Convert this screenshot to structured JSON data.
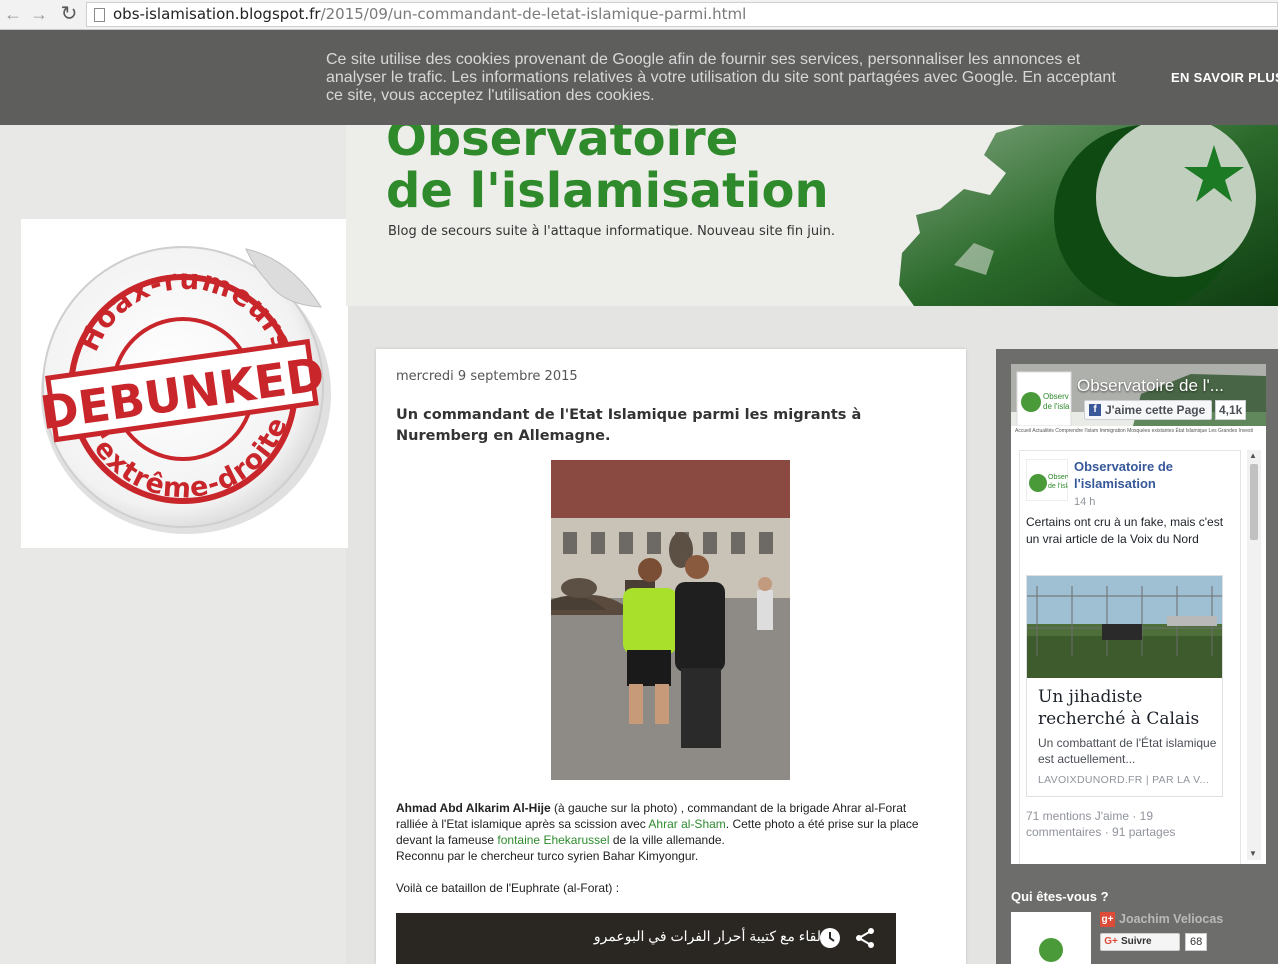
{
  "browser": {
    "url_host": "obs-islamisation.blogspot.fr",
    "url_path": "/2015/09/un-commandant-de-letat-islamique-parmi.html"
  },
  "cookie_banner": {
    "text": "Ce site utilise des cookies provenant de Google afin de fournir ses services, personnaliser les annonces et analyser le trafic. Les informations relatives à votre utilisation du site sont partagées avec Google. En acceptant ce site, vous acceptez l'utilisation des cookies.",
    "learn_more": "EN SAVOIR PLUS"
  },
  "sticker": {
    "top_text": "Hoax-rumeurs",
    "stamp": "DEBUNKED",
    "bottom_text": "d'extrême-droite"
  },
  "header": {
    "title_line1": "Observatoire",
    "title_line2": "de l'islamisation",
    "description": "Blog de secours suite à l'attaque informatique. Nouveau site fin juin."
  },
  "post": {
    "date": "mercredi 9 septembre 2015",
    "title": "Un commandant de l'Etat Islamique parmi les migrants à Nuremberg en Allemagne.",
    "body": {
      "name": "Ahmad Abd Alkarim Al-Hije",
      "p1a": " (à gauche sur la photo) , commandant de la brigade Ahrar al-Forat ralliée à l'Etat islamique après sa scission avec ",
      "link1": "Ahrar al-Sham",
      "p1b": ". Cette photo a été prise sur la place devant la fameuse ",
      "link2": "fontaine Ehekarussel",
      "p1c": " de la ville allemande.",
      "p2": "Reconnu par le chercheur turco syrien Bahar Kimyongur.",
      "p3": "Voilà ce bataillon de l'Euphrate (al-Forat) :"
    },
    "video_title": "لقاء مع كتيبة أحرار الفرات في البوعمرو"
  },
  "sidebar": {
    "facebook": {
      "page_name": "Observatoire de l'...",
      "like_button": "J'aime cette Page",
      "like_count": "4,1k",
      "post_author": "Observatoire de l'islamisation",
      "post_time": "14 h",
      "post_text": "Certains ont cru à un fake, mais c'est un vrai article de la Voix du Nord",
      "link_title": "Un jihadiste recherché à Calais",
      "link_desc": "Un combattant de l'État islamique est actuellement...",
      "link_source": "LAVOIXDUNORD.FR | PAR LA V...",
      "stats": "71 mentions J'aime · 19 commentaires · 91 partages"
    },
    "who": {
      "title": "Qui êtes-vous ?",
      "name": "Joachim Veliocas",
      "follow_label": "Suivre",
      "follow_count": "68"
    }
  }
}
